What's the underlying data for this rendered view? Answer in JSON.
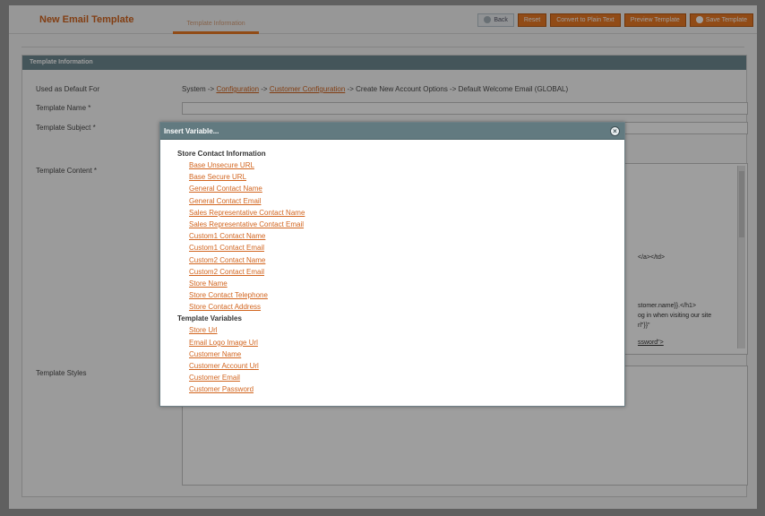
{
  "header": {
    "title": "New Email Template",
    "tab_label": "Template Information",
    "buttons": {
      "back": "Back",
      "reset": "Reset",
      "convert": "Convert to Plain Text",
      "preview": "Preview Template",
      "save": "Save Template"
    }
  },
  "section": {
    "title": "Template Information",
    "labels": {
      "used_default": "Used as Default For",
      "name": "Template Name *",
      "subject": "Template Subject *",
      "content": "Template Content *",
      "styles": "Template Styles"
    },
    "used_default": {
      "prefix": "System -> ",
      "link1": "Configuration",
      "mid": " -> ",
      "link2": "Customer Configuration",
      "suffix": " -> Create New Account Options -> Default Welcome Email  (GLOBAL)"
    },
    "content_fragments": {
      "line1": "</a></td>",
      "line2": "stomer.name}}.</h1>",
      "line3": "og in when visiting our site",
      "line4": "rl\"}}\"",
      "line5": "ssword\">"
    }
  },
  "dialog": {
    "title": "Insert Variable...",
    "groups": [
      {
        "title": "Store Contact Information",
        "items": [
          "Base Unsecure URL",
          "Base Secure URL",
          "General Contact Name",
          "General Contact Email",
          "Sales Representative Contact Name",
          "Sales Representative Contact Email",
          "Custom1 Contact Name",
          "Custom1 Contact Email",
          "Custom2 Contact Name",
          "Custom2 Contact Email",
          "Store Name",
          "Store Contact Telephone",
          "Store Contact Address"
        ]
      },
      {
        "title": "Template Variables",
        "items": [
          "Store Url",
          "Email Logo Image Url",
          "Customer Name",
          "Customer Account Url",
          "Customer Email",
          "Customer Password"
        ]
      }
    ]
  },
  "colors": {
    "accent": "#ea7a25",
    "link": "#d2651f",
    "dialog_header": "#627a80"
  }
}
